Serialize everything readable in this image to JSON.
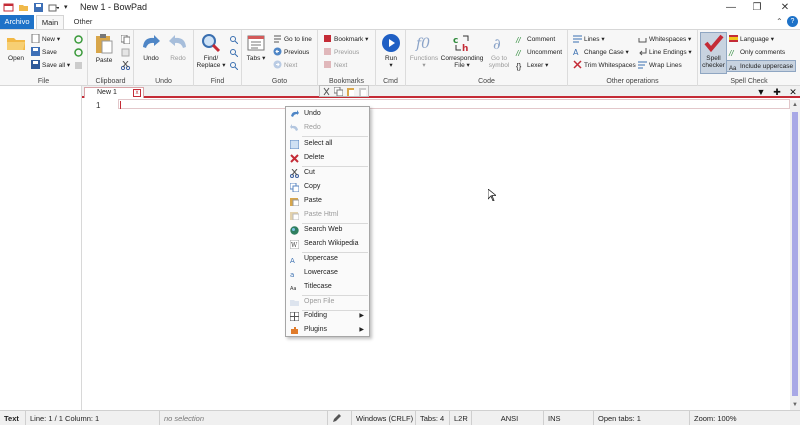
{
  "window": {
    "title": "New 1 - BowPad",
    "controls": [
      "minimize",
      "restore",
      "close"
    ]
  },
  "tabs": {
    "file": "Archivo",
    "main": "Main",
    "other": "Other"
  },
  "ribbon": {
    "file": {
      "label": "File",
      "open": "Open",
      "new": "New",
      "save": "Save",
      "save_all": "Save all"
    },
    "clipboard": {
      "label": "Clipboard",
      "paste": "Paste"
    },
    "undo": {
      "label": "Undo",
      "undo": "Undo",
      "redo": "Redo"
    },
    "find": {
      "label": "Find",
      "find_replace_line1": "Find/",
      "find_replace_line2": "Replace"
    },
    "goto": {
      "label": "Goto",
      "tabs": "Tabs",
      "go_to_line": "Go to line",
      "previous": "Previous",
      "next": "Next"
    },
    "bookmarks": {
      "label": "Bookmarks",
      "bookmark": "Bookmark",
      "previous": "Previous",
      "next": "Next"
    },
    "cmd": {
      "label": "Cmd",
      "run": "Run"
    },
    "code": {
      "label": "Code",
      "functions": "Functions",
      "corresponding_line1": "Corresponding",
      "corresponding_line2": "File",
      "goto_symbol_line1": "Go to",
      "goto_symbol_line2": "symbol",
      "comment": "Comment",
      "uncomment": "Uncomment",
      "lexer": "Lexer"
    },
    "other_ops": {
      "label": "Other operations",
      "lines": "Lines",
      "change_case": "Change Case",
      "trim_whitespaces": "Trim Whitespaces",
      "whitespaces": "Whitespaces",
      "line_endings": "Line Endings",
      "wrap_lines": "Wrap Lines"
    },
    "spell": {
      "label": "Spell Check",
      "spell_line1": "Spell",
      "spell_line2": "checker",
      "language": "Language",
      "only_comments": "Only comments",
      "include_uppercase": "Include uppercase"
    }
  },
  "document": {
    "tab_label": "New 1",
    "line_number": "1"
  },
  "context_menu": {
    "items": [
      {
        "label": "Undo",
        "enabled": true,
        "icon": "undo-icon"
      },
      {
        "label": "Redo",
        "enabled": false,
        "icon": "redo-icon"
      },
      {
        "label": "Select all",
        "enabled": true,
        "icon": "select-all-icon"
      },
      {
        "label": "Delete",
        "enabled": true,
        "icon": "delete-icon"
      },
      {
        "label": "Cut",
        "enabled": true,
        "icon": "cut-icon"
      },
      {
        "label": "Copy",
        "enabled": true,
        "icon": "copy-icon"
      },
      {
        "label": "Paste",
        "enabled": true,
        "icon": "paste-icon"
      },
      {
        "label": "Paste Html",
        "enabled": false,
        "icon": "paste-html-icon"
      },
      {
        "label": "Search Web",
        "enabled": true,
        "icon": "globe-icon"
      },
      {
        "label": "Search Wikipedia",
        "enabled": true,
        "icon": "wikipedia-icon"
      },
      {
        "label": "Uppercase",
        "enabled": true,
        "icon": "uppercase-icon"
      },
      {
        "label": "Lowercase",
        "enabled": true,
        "icon": "lowercase-icon"
      },
      {
        "label": "Titlecase",
        "enabled": true,
        "icon": "titlecase-icon"
      },
      {
        "label": "Open File",
        "enabled": false,
        "icon": "open-file-icon"
      },
      {
        "label": "Folding",
        "enabled": true,
        "icon": "folding-icon",
        "submenu": true
      },
      {
        "label": "Plugins",
        "enabled": true,
        "icon": "plugins-icon",
        "submenu": true
      }
    ]
  },
  "statusbar": {
    "mode": "Text",
    "position": "Line: 1 / 1    Column: 1",
    "selection": "no selection",
    "eol": "Windows (CRLF)",
    "tabs": "Tabs: 4",
    "direction": "L2R",
    "encoding": "ANSI",
    "ins": "INS",
    "open_tabs": "Open tabs: 1",
    "zoom": "Zoom: 100%"
  },
  "colors": {
    "accent": "#1e72c8",
    "tab_red": "#c42b36",
    "scroll_thumb": "#a9a9e6"
  }
}
